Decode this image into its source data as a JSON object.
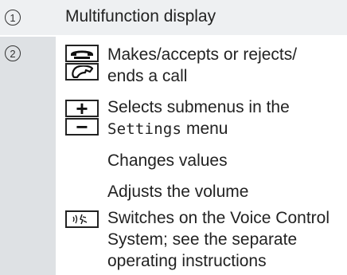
{
  "rows": [
    {
      "number": "1",
      "description": "Multifunction display"
    },
    {
      "number": "2",
      "items": [
        {
          "icons": [
            "phone-accept-icon",
            "phone-end-icon"
          ],
          "lines": [
            "Makes/accepts or rejects/",
            "ends a call"
          ]
        },
        {
          "icons": [
            "plus-icon",
            "minus-icon"
          ],
          "lines": [
            "Selects submenus in the"
          ],
          "menu_name": "Settings",
          "menu_suffix": " menu",
          "extra_lines": [
            "Changes values",
            "Adjusts the volume"
          ]
        },
        {
          "icons": [
            "voice-control-icon"
          ],
          "lines": [
            "Switches on the Voice Control",
            "System; see the separate",
            "operating instructions"
          ]
        }
      ]
    }
  ],
  "keys": {
    "plus": "+",
    "minus": "−"
  }
}
